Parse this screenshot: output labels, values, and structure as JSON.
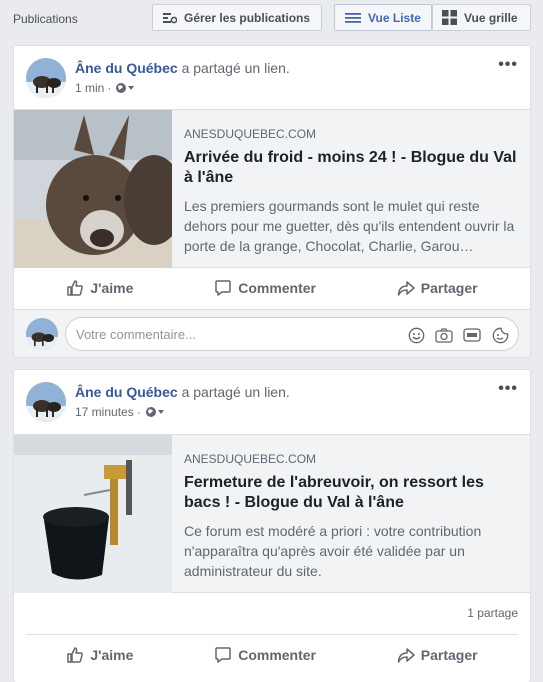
{
  "header": {
    "title": "Publications",
    "manage_label": "Gérer les publications",
    "list_label": "Vue Liste",
    "grid_label": "Vue grille"
  },
  "posts": [
    {
      "author": "Âne du Québec",
      "action": "a partagé un lien.",
      "time": "1 min",
      "link": {
        "domain": "ANESDUQUEBEC.COM",
        "title": "Arrivée du froid - moins 24 ! - Blogue du Val à l'âne",
        "description": "Les premiers gourmands sont le mulet qui reste dehors pour me guetter, dès qu'ils entendent ouvrir la porte de la grange, Chocolat, Charlie, Garou…"
      },
      "actions": {
        "like": "J'aime",
        "comment": "Commenter",
        "share": "Partager"
      },
      "comment_placeholder": "Votre commentaire..."
    },
    {
      "author": "Âne du Québec",
      "action": "a partagé un lien.",
      "time": "17 minutes",
      "link": {
        "domain": "ANESDUQUEBEC.COM",
        "title": "Fermeture de l'abreuvoir, on ressort les bacs ! - Blogue du Val à l'âne",
        "description": "Ce forum est modéré a priori : votre contribution n'apparaîtra qu'après avoir été validée par un administrateur du site."
      },
      "shares": "1 partage",
      "actions": {
        "like": "J'aime",
        "comment": "Commenter",
        "share": "Partager"
      }
    }
  ],
  "colors": {
    "author": "#385898",
    "accent": "#4267b2",
    "background": "#e9ebee"
  }
}
